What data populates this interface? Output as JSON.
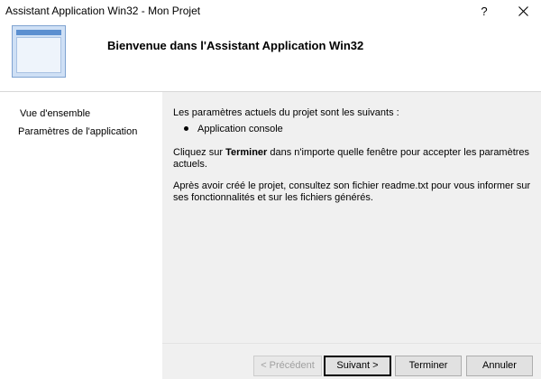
{
  "window": {
    "title": "Assistant Application Win32 - Mon Projet",
    "help_label": "?",
    "close_icon": "close-icon"
  },
  "header": {
    "title": "Bienvenue dans l'Assistant Application Win32",
    "icon": "application-window-icon"
  },
  "nav": {
    "items": [
      {
        "label": "Vue d'ensemble",
        "active": true
      },
      {
        "label": "Paramètres de l'application",
        "active": false
      }
    ]
  },
  "content": {
    "intro": "Les paramètres actuels du projet sont les suivants :",
    "bullets": [
      "Application console"
    ],
    "finish_before": "Cliquez sur ",
    "finish_bold": "Terminer",
    "finish_after": " dans n'importe quelle fenêtre pour accepter les paramètres actuels.",
    "readme": "Après avoir créé le projet, consultez son fichier readme.txt pour vous informer sur ses fonctionnalités et sur les fichiers générés."
  },
  "buttons": {
    "previous": "< Précédent",
    "next": "Suivant >",
    "finish": "Terminer",
    "cancel": "Annuler"
  }
}
